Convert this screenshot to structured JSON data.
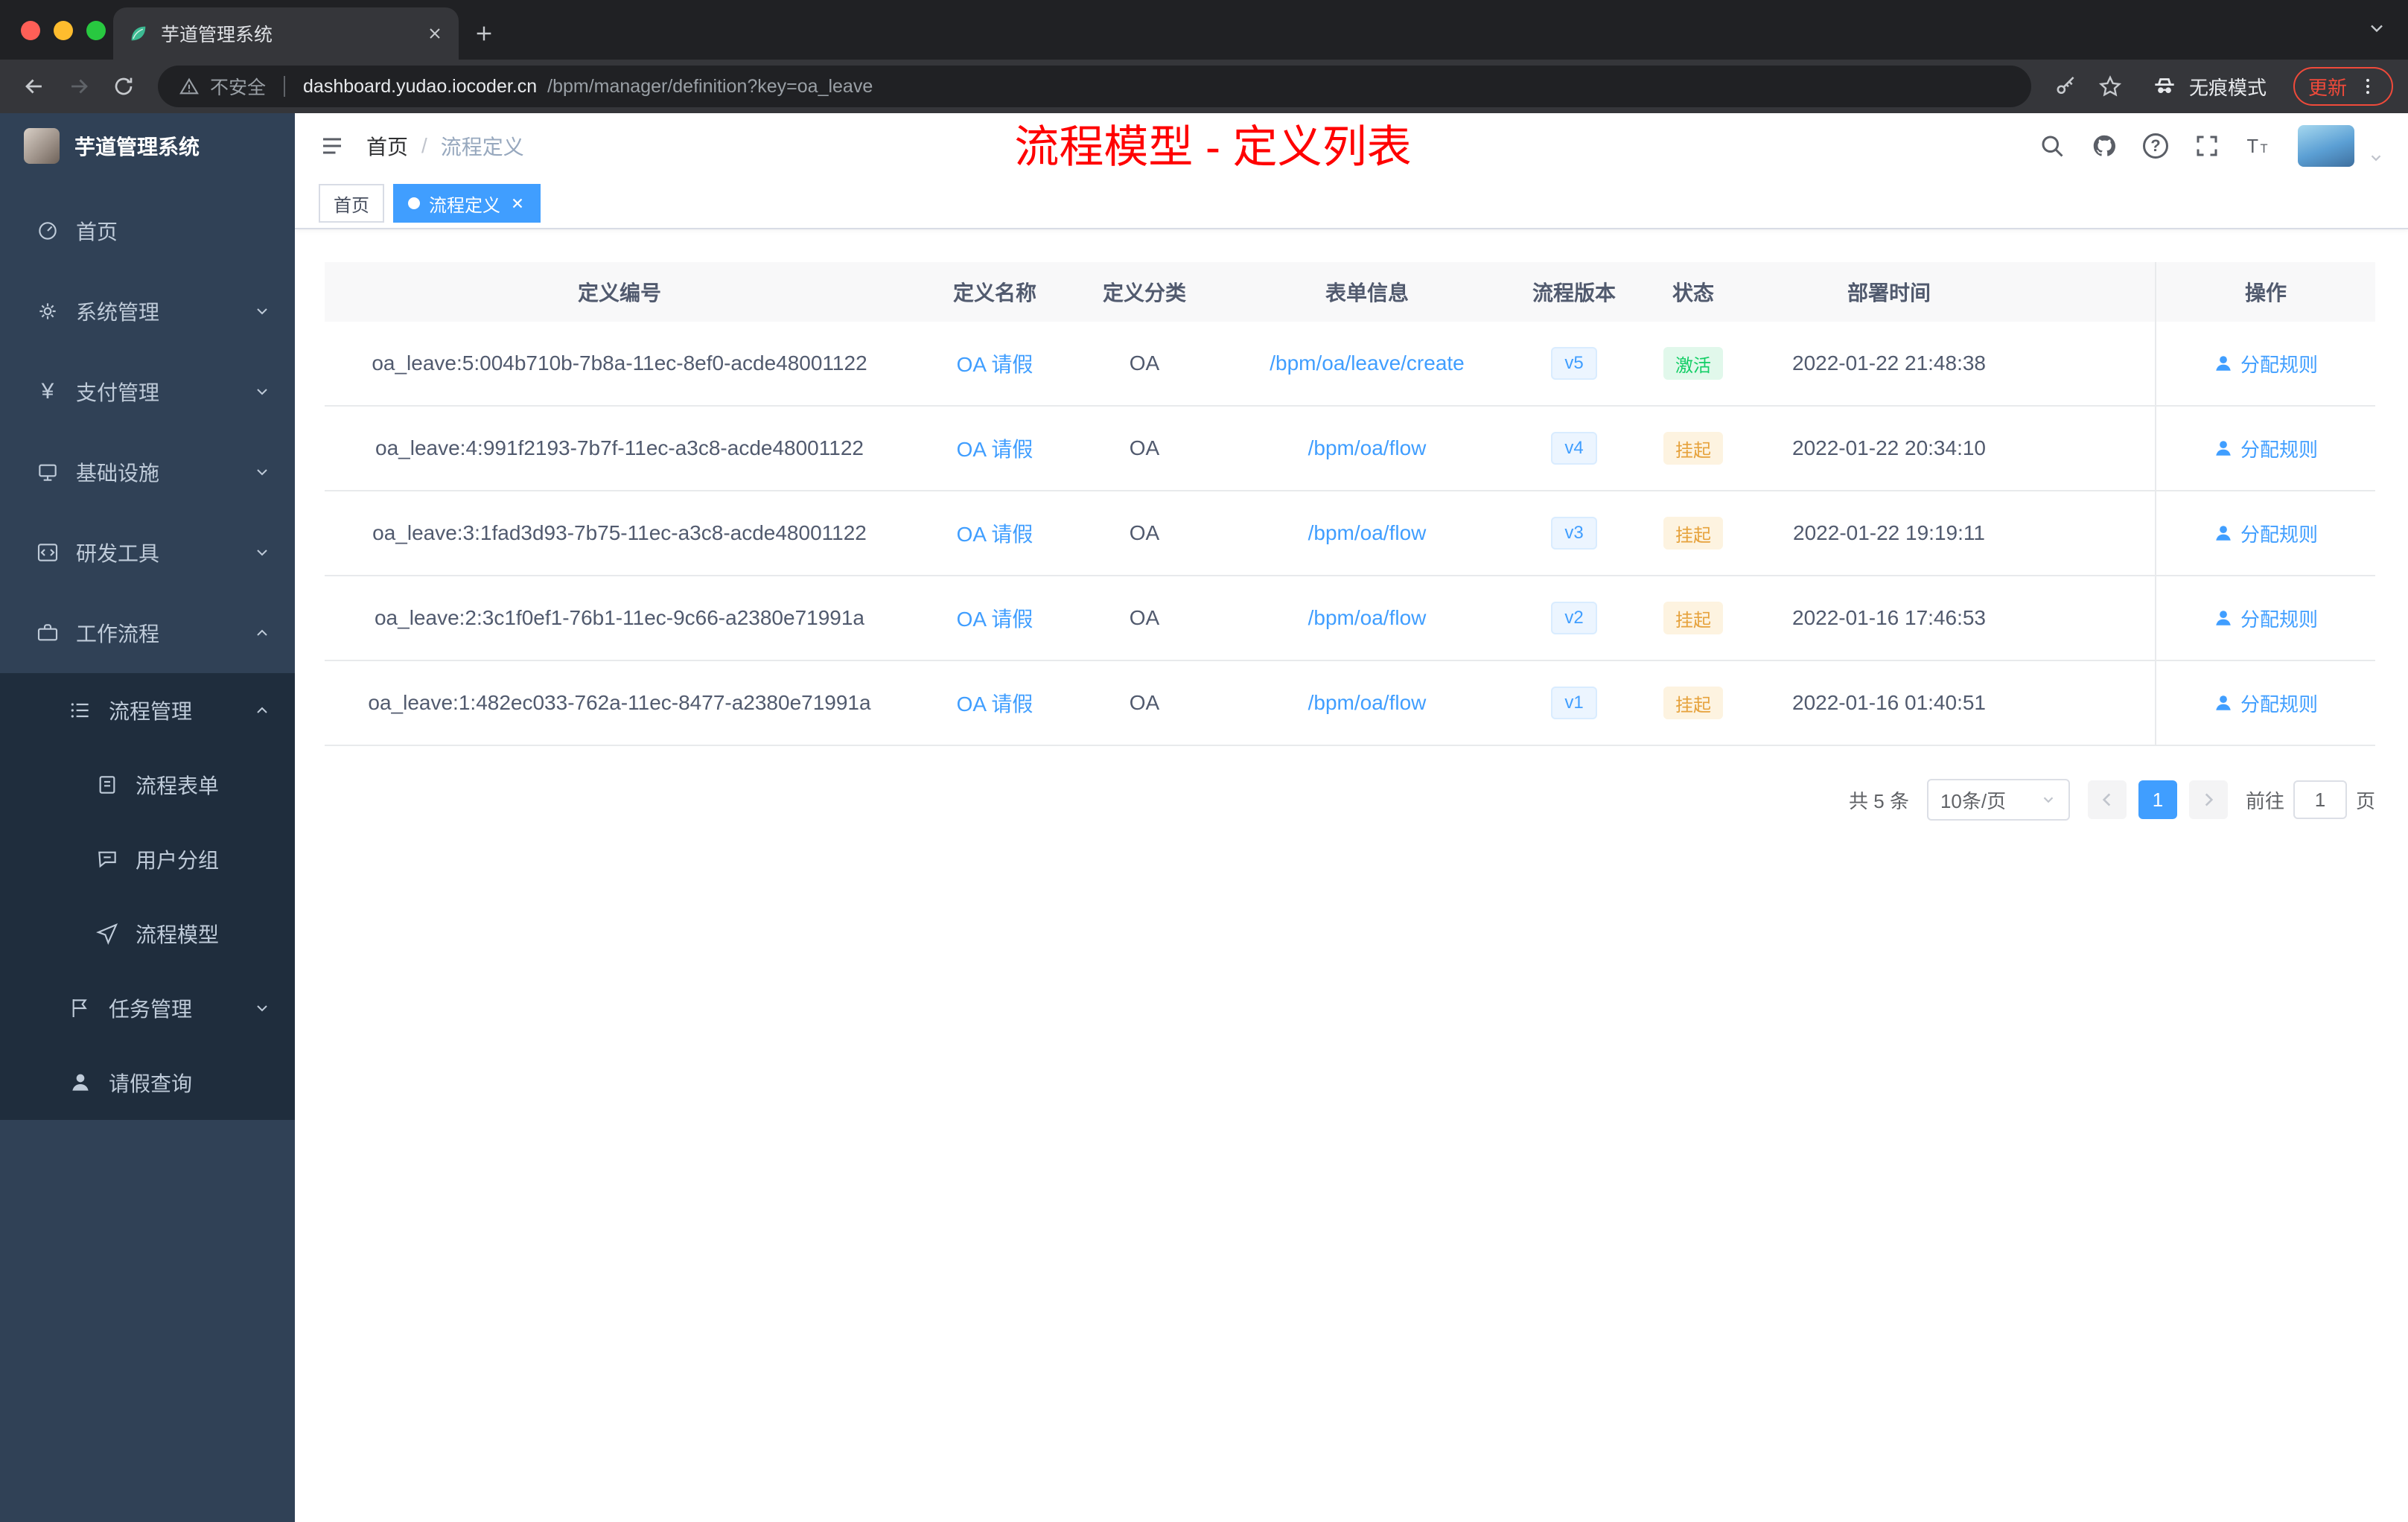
{
  "browser": {
    "tab_title": "芋道管理系统",
    "not_secure": "不安全",
    "url_host": "dashboard.yudao.iocoder.cn",
    "url_path": "/bpm/manager/definition?key=oa_leave",
    "incognito_label": "无痕模式",
    "update_label": "更新"
  },
  "sidebar": {
    "logo_title": "芋道管理系统",
    "items": [
      {
        "label": "首页"
      },
      {
        "label": "系统管理"
      },
      {
        "label": "支付管理"
      },
      {
        "label": "基础设施"
      },
      {
        "label": "研发工具"
      },
      {
        "label": "工作流程"
      },
      {
        "label": "流程管理"
      },
      {
        "label": "流程表单"
      },
      {
        "label": "用户分组"
      },
      {
        "label": "流程模型"
      },
      {
        "label": "任务管理"
      },
      {
        "label": "请假查询"
      }
    ]
  },
  "navbar": {
    "breadcrumb": {
      "home": "首页",
      "separator": "/",
      "current": "流程定义"
    },
    "annotation": "流程模型 - 定义列表"
  },
  "tags_view": {
    "home": "首页",
    "active": "流程定义"
  },
  "table": {
    "headers": [
      "定义编号",
      "定义名称",
      "定义分类",
      "表单信息",
      "流程版本",
      "状态",
      "部署时间",
      "操作"
    ],
    "rows": [
      {
        "id": "oa_leave:5:004b710b-7b8a-11ec-8ef0-acde48001122",
        "name": "OA 请假",
        "category": "OA",
        "form": "/bpm/oa/leave/create",
        "version": "v5",
        "status": "激活",
        "status_type": "success",
        "time": "2022-01-22 21:48:38",
        "action": "分配规则"
      },
      {
        "id": "oa_leave:4:991f2193-7b7f-11ec-a3c8-acde48001122",
        "name": "OA 请假",
        "category": "OA",
        "form": "/bpm/oa/flow",
        "version": "v4",
        "status": "挂起",
        "status_type": "warning",
        "time": "2022-01-22 20:34:10",
        "action": "分配规则"
      },
      {
        "id": "oa_leave:3:1fad3d93-7b75-11ec-a3c8-acde48001122",
        "name": "OA 请假",
        "category": "OA",
        "form": "/bpm/oa/flow",
        "version": "v3",
        "status": "挂起",
        "status_type": "warning",
        "time": "2022-01-22 19:19:11",
        "action": "分配规则"
      },
      {
        "id": "oa_leave:2:3c1f0ef1-76b1-11ec-9c66-a2380e71991a",
        "name": "OA 请假",
        "category": "OA",
        "form": "/bpm/oa/flow",
        "version": "v2",
        "status": "挂起",
        "status_type": "warning",
        "time": "2022-01-16 17:46:53",
        "action": "分配规则"
      },
      {
        "id": "oa_leave:1:482ec033-762a-11ec-8477-a2380e71991a",
        "name": "OA 请假",
        "category": "OA",
        "form": "/bpm/oa/flow",
        "version": "v1",
        "status": "挂起",
        "status_type": "warning",
        "time": "2022-01-16 01:40:51",
        "action": "分配规则"
      }
    ]
  },
  "pagination": {
    "total": "共 5 条",
    "page_size": "10条/页",
    "current_page": "1",
    "goto_label": "前往",
    "goto_value": "1",
    "goto_unit": "页"
  },
  "colors": {
    "accent": "#409eff",
    "success_text": "#13ce66",
    "warning_text": "#e6a23c",
    "annotation_red": "#ff0000",
    "sidebar_bg": "#304156",
    "submenu_bg": "#1f2d3d"
  }
}
